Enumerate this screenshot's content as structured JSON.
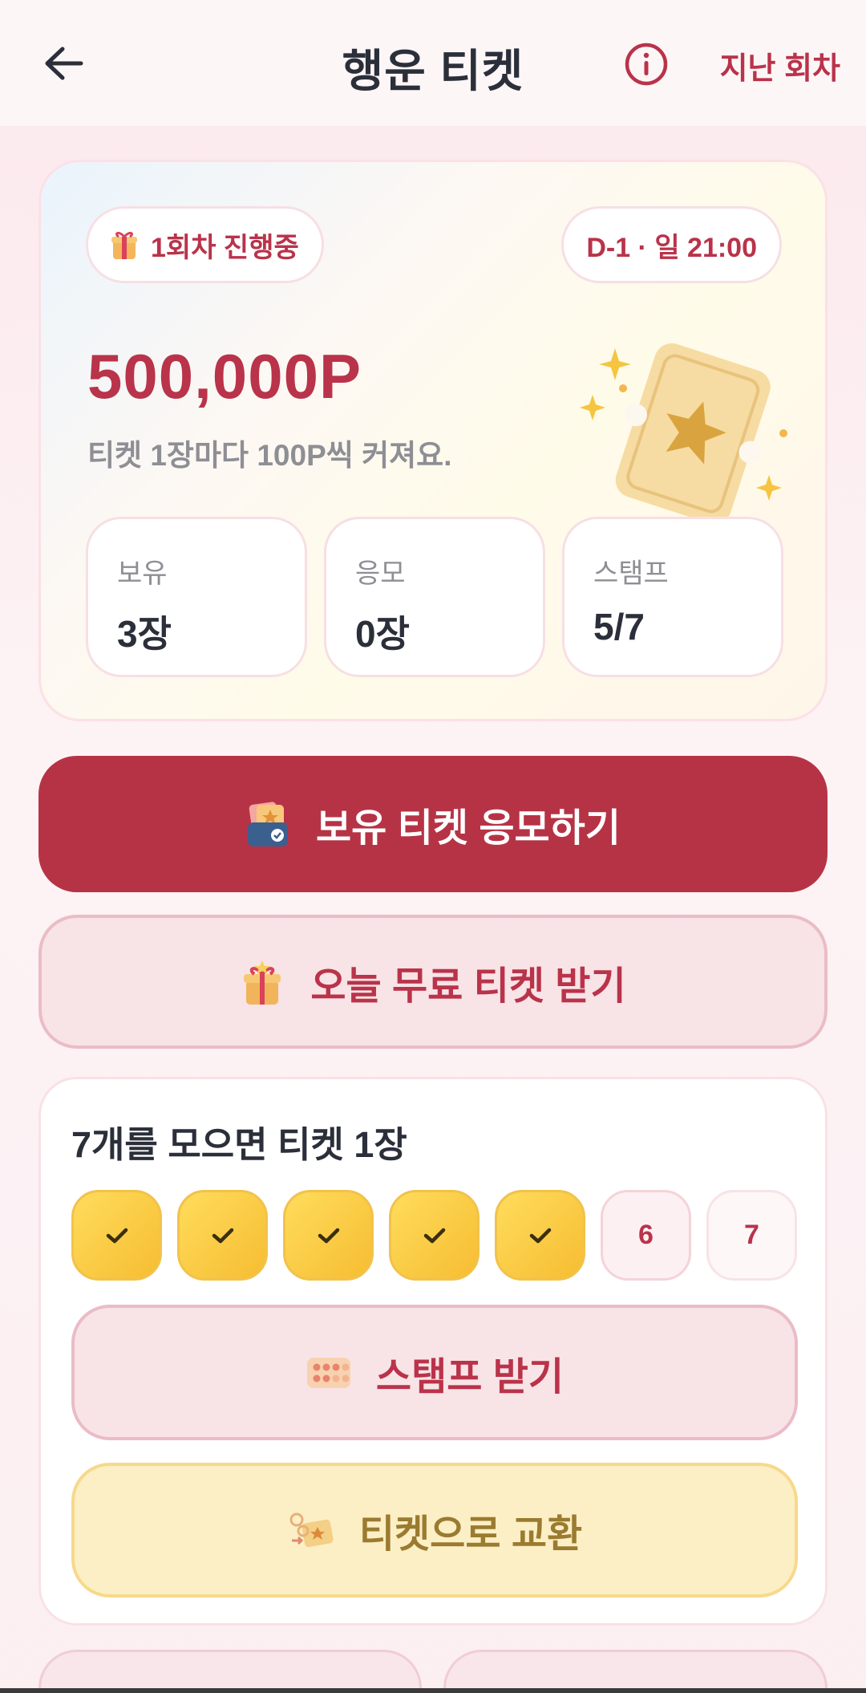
{
  "header": {
    "title": "행운 티켓",
    "past_rounds": "지난 회차"
  },
  "hero": {
    "round_status": "1회차 진행중",
    "deadline": "D-1 · 일 21:00",
    "prize": "500,000P",
    "prize_desc": "티켓 1장마다 100P씩 커져요.",
    "stats": [
      {
        "label": "보유",
        "value": "3장"
      },
      {
        "label": "응모",
        "value": "0장"
      },
      {
        "label": "스탬프",
        "value": "5/7"
      }
    ]
  },
  "actions": {
    "enter_label": "보유 티켓 응모하기",
    "free_label": "오늘 무료 티켓 받기"
  },
  "stamps": {
    "title": "7개를 모으면 티켓 1장",
    "remaining": [
      "6",
      "7"
    ],
    "collected_count": 5,
    "get_stamp_label": "스탬프 받기",
    "exchange_label": "티켓으로 교환"
  },
  "colors": {
    "primary": "#b63345",
    "accent_text": "#b9334a",
    "stamp_gold": "#f6bd32"
  }
}
